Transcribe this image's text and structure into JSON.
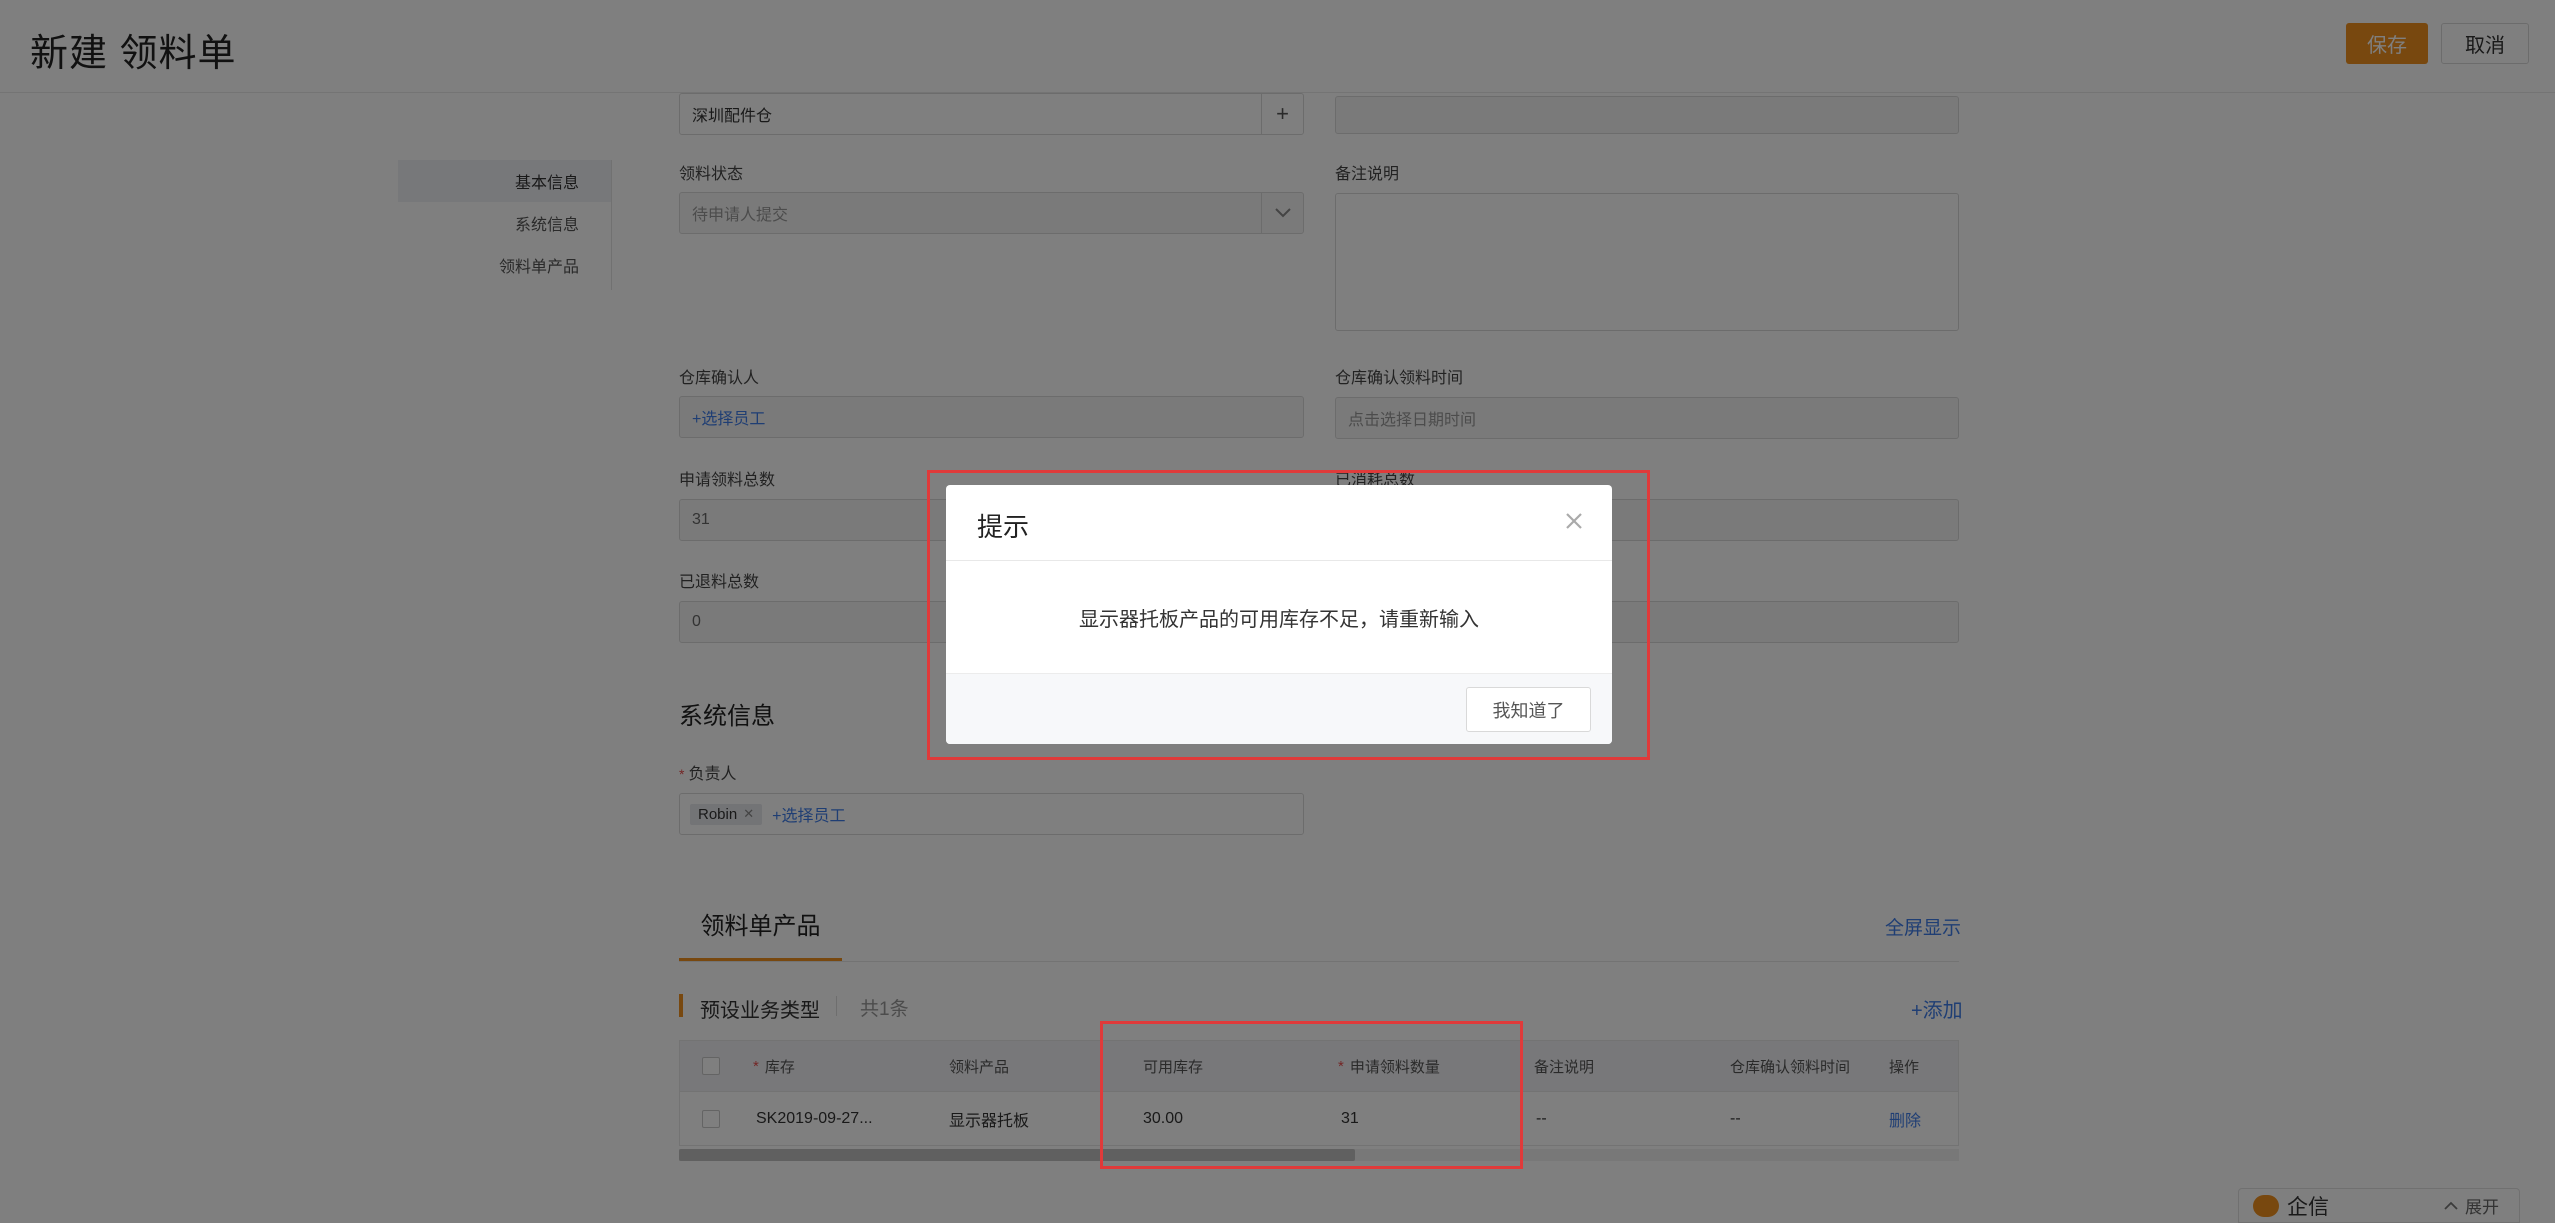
{
  "header": {
    "title": "新建 领料单",
    "save_label": "保存",
    "cancel_label": "取消"
  },
  "anchor_nav": {
    "items": [
      {
        "label": "基本信息",
        "active": true
      },
      {
        "label": "系统信息",
        "active": false
      },
      {
        "label": "领料单产品",
        "active": false
      }
    ]
  },
  "form": {
    "warehouse_value": "深圳配件仓",
    "status_label": "领料状态",
    "status_value": "待申请人提交",
    "remark_label": "备注说明",
    "confirmer_label": "仓库确认人",
    "confirmer_placeholder": "+选择员工",
    "confirm_time_label": "仓库确认领料时间",
    "confirm_time_placeholder": "点击选择日期时间",
    "apply_total_label": "申请领料总数",
    "apply_total_value": "31",
    "consumed_total_label": "已消耗总数",
    "returned_total_label": "已退料总数",
    "returned_total_value": "0"
  },
  "system_info": {
    "title": "系统信息",
    "owner_label": "负责人",
    "owner_tag": "Robin",
    "owner_add": "+选择员工"
  },
  "products": {
    "tab_label": "领料单产品",
    "fullscreen_label": "全屏显示",
    "biz_type_label": "预设业务类型",
    "count_label": "共1条",
    "add_label": "+添加",
    "columns": [
      "库存",
      "领料产品",
      "可用库存",
      "申请领料数量",
      "备注说明",
      "仓库确认领料时间",
      "操作"
    ],
    "rows": [
      {
        "stock": "SK2019-09-27...",
        "product": "显示器托板",
        "available": "30.00",
        "apply_qty": "31",
        "remark": "--",
        "confirm_time": "--",
        "action": "删除"
      }
    ]
  },
  "chat_widget": {
    "label": "企信",
    "expand_label": "展开"
  },
  "dialog": {
    "title": "提示",
    "message": "显示器托板产品的可用库存不足，请重新输入",
    "ok_label": "我知道了"
  },
  "colors": {
    "accent": "#f0901e",
    "link": "#3f7de8",
    "highlight": "#e03a3a"
  }
}
